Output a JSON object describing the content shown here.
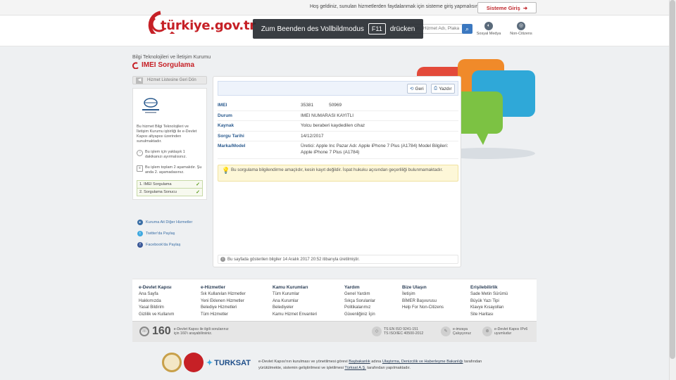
{
  "topbar": {
    "welcome": "Hoş geldiniz, sunulan hizmetlerden faydalanmak için sisteme giriş yapmalısınız.",
    "login_label": "Sisteme Giriş"
  },
  "header": {
    "logo_text": "türkiye.gov.tr",
    "search_placeholder": "Kurum, Hizmet Adı, Plaka No...",
    "links": [
      "Sosyal Medya",
      "Non-Citizens"
    ]
  },
  "fullscreen_notice": {
    "before": "Zum Beenden des Vollbildmodus",
    "key": "F11",
    "after": "drücken"
  },
  "page": {
    "org": "Bilgi Teknolojileri ve İletişim Kurumu",
    "title": "IMEI Sorgulama"
  },
  "sidebar": {
    "back_label": "Hizmet Listesine Geri Dön",
    "description": "Bu hizmet Bilgi Teknolojileri ve İletişim Kurumu işbirliği ile e-Devlet Kapısı altyapısı üzerinden sunulmaktadır.",
    "note_time": "Bu işlem için yaklaşık 1 dakikanızı ayırmalısınız.",
    "note_steps": "Bu işlem toplam 2 aşamalıdır. Şu anda 2. aşamadasınız.",
    "steps": [
      "1. IMEI Sorgulama",
      "2. Sorgulama Sonucu"
    ],
    "links": [
      "Kuruma Ait Diğer Hizmetler",
      "Twitter'da Paylaş",
      "Facebook'da Paylaş"
    ]
  },
  "toolbar": {
    "back_label": "Geri",
    "print_label": "Yazdır"
  },
  "result": {
    "imei_label": "IMEI",
    "imei_part1": "35381",
    "imei_part2": "50969",
    "durum_label": "Durum",
    "durum_value": "IMEI NUMARASI KAYITLI",
    "kaynak_label": "Kaynak",
    "kaynak_value": "Yolcu beraberi kaydedilen cihaz",
    "tarih_label": "Sorgu Tarihi",
    "tarih_value": "14/12/2017",
    "model_label": "Marka/Model",
    "model_value": "Üretici: Apple Inc Pazar Adı: Apple iPhone 7 Plus (A1784) Model Bilgileri: Apple iPhone 7 Plus (A1784)"
  },
  "warning": "Bu sorgulama bilgilendirme amaçlıdır, kesin kayıt değildir. İspat hukuku açısından geçerliliği bulunmamaktadır.",
  "footnote": "Bu sayfada gösterilen bilgiler 14 Aralık 2017 20:52 itibarıyla üretilmiştir.",
  "footer": {
    "cols": [
      {
        "title": "e-Devlet Kapısı",
        "items": [
          "Ana Sayfa",
          "Hakkımızda",
          "Yasal Bildirim",
          "Gizlilik ve Kullanım"
        ]
      },
      {
        "title": "e-Hizmetler",
        "items": [
          "Sık Kullanılan Hizmetler",
          "Yeni Eklenen Hizmetler",
          "Belediye Hizmetleri",
          "Tüm Hizmetler"
        ]
      },
      {
        "title": "Kamu Kurumları",
        "items": [
          "Tüm Kurumlar",
          "Ana Kurumlar",
          "Belediyeler",
          "Kamu Hizmet Envanteri"
        ]
      },
      {
        "title": "Yardım",
        "items": [
          "Genel Yardım",
          "Sıkça Sorulanlar",
          "Politikalarımız",
          "Güvenliğiniz İçin"
        ]
      },
      {
        "title": "Bize Ulaşın",
        "items": [
          "İletişim",
          "BİMER Başvurusu",
          "Help For Non-Citizens"
        ]
      },
      {
        "title": "Erişilebilirlik",
        "items": [
          "Sade Metin Sürümü",
          "Büyük Yazı Tipi",
          "Klavye Kısayolları",
          "Site Haritası"
        ]
      }
    ]
  },
  "bottom": {
    "num_160": "160",
    "text_160": "e-Devlet Kapısı ile ilgili sorularınız için 160'ı arayabilirsiniz.",
    "iso": "TS EN ISO 9241-151\nTS ISO/IEC 40500-2012",
    "engine": "e-imzaya\nÇalışıyoruz",
    "ipv6": "e-Devlet Kapısı IPv6\nuyumludur"
  },
  "partners": {
    "turksat": "TURKSAT",
    "line1_a": "e-Devlet Kapısı'nın kurulması ve yönetilmesi görevi ",
    "line1_b": "Başbakanlık",
    "line1_c": " adına ",
    "line1_d": "Ulaştırma, Denizcilik ve Haberleşme Bakanlığı",
    "line1_e": " tarafından",
    "line2_a": "yürütülmekte, sistemin geliştirilmesi ve işletilmesi ",
    "line2_b": "Türksat A.Ş.",
    "line2_c": " tarafından yapılmaktadır."
  }
}
